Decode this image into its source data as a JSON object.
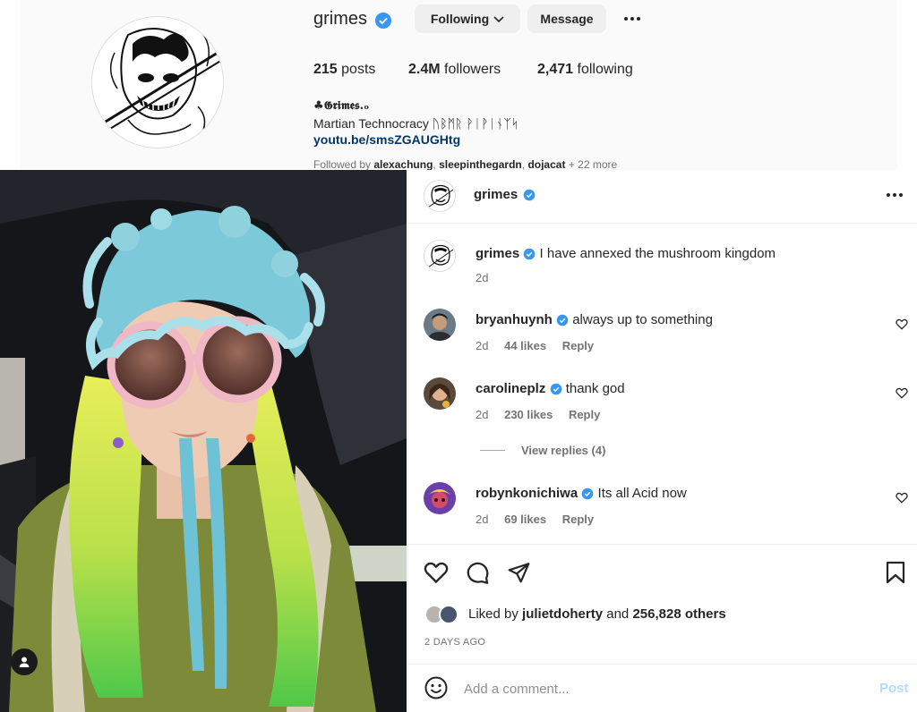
{
  "profile": {
    "username": "grimes",
    "following_label": "Following",
    "message_label": "Message",
    "posts_count": "215",
    "posts_label": "posts",
    "followers_count": "2.4M",
    "followers_label": "followers",
    "following_count": "2,471",
    "following_stat_label": "following",
    "bio_name": "♣𝕲𝖗𝖎𝖒𝖊𝖘.ₒ",
    "bio_line": "Martian Technocracy ᚢᛒᛗᚱ ᚹᛁᚹᛁᚾᛉᛋ",
    "bio_link": "youtu.be/smsZGAUGHtg",
    "followed_by_prefix": "Followed by",
    "followed_by_names": [
      "alexachung",
      "sleepinthegardn",
      "dojacat"
    ],
    "followed_by_more": "+ 22 more"
  },
  "post": {
    "header_username": "grimes",
    "caption_username": "grimes",
    "caption_text": "I have annexed the mushroom kingdom",
    "caption_time": "2d",
    "comments": [
      {
        "username": "bryanhuynh",
        "text": "always up to something",
        "time": "2d",
        "likes": "44 likes",
        "reply": "Reply"
      },
      {
        "username": "carolineplz",
        "text": "thank god",
        "time": "2d",
        "likes": "230 likes",
        "reply": "Reply"
      },
      {
        "username": "robynkonichiwa",
        "text": "Its all Acid now",
        "time": "2d",
        "likes": "69 likes",
        "reply": "Reply"
      }
    ],
    "view_replies": "View replies (4)",
    "liked_by_prefix": "Liked by",
    "liked_by_user": "julietdoherty",
    "liked_by_and": "and",
    "liked_by_others": "256,828 others",
    "time_ago": "2 DAYS AGO",
    "comment_placeholder": "Add a comment...",
    "post_label": "Post"
  },
  "colors": {
    "verified": "#3897f0",
    "link": "#00376b",
    "post_button_disabled": "#b3dbff",
    "button_bg": "#efefef"
  },
  "icons": [
    "verified-badge-icon",
    "chevron-down-icon",
    "more-icon",
    "heart-icon",
    "comment-icon",
    "share-icon",
    "bookmark-icon",
    "emoji-icon",
    "user-tag-icon"
  ]
}
